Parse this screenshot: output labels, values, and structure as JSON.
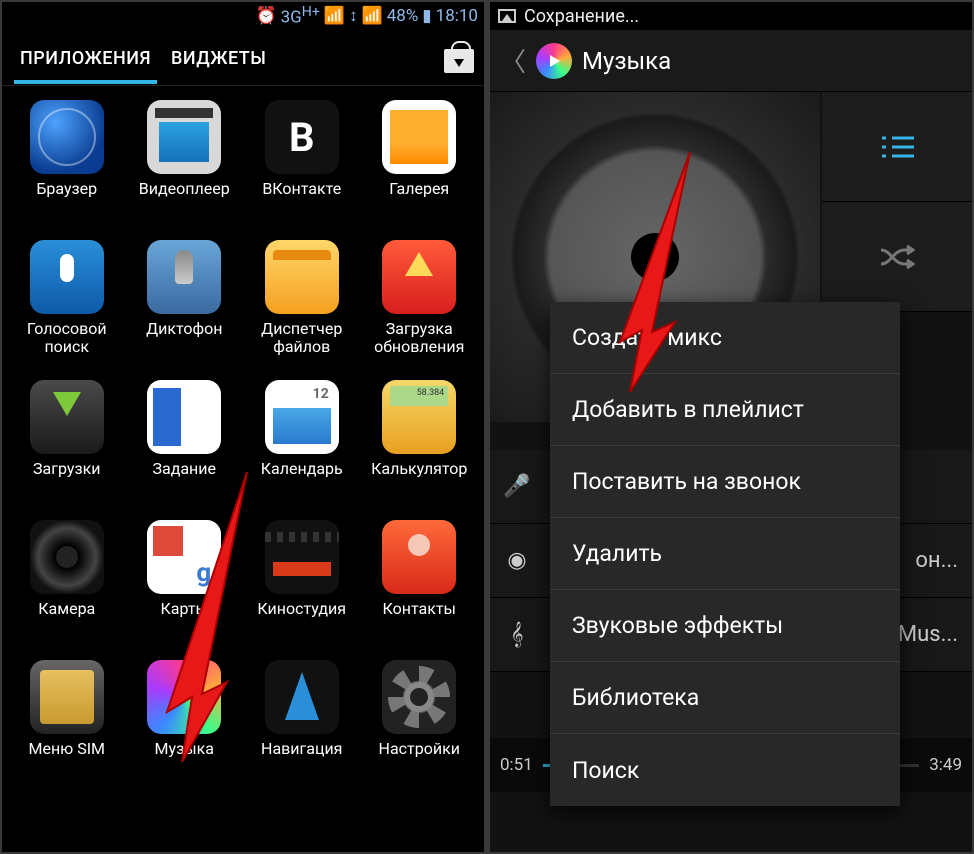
{
  "left": {
    "status": {
      "network": "3G",
      "network_sup": "H+",
      "battery": "48%",
      "time": "18:10"
    },
    "tabs": {
      "apps": "ПРИЛОЖЕНИЯ",
      "widgets": "ВИДЖЕТЫ"
    },
    "apps": [
      {
        "id": "browser",
        "label": "Браузер"
      },
      {
        "id": "video",
        "label": "Видеоплеер"
      },
      {
        "id": "vk",
        "label": "ВКонтакте"
      },
      {
        "id": "gallery",
        "label": "Галерея"
      },
      {
        "id": "voice",
        "label": "Голосовой\nпоиск"
      },
      {
        "id": "rec",
        "label": "Диктофон"
      },
      {
        "id": "files",
        "label": "Диспетчер\nфайлов"
      },
      {
        "id": "update",
        "label": "Загрузка\nобновления"
      },
      {
        "id": "downloads",
        "label": "Загрузки"
      },
      {
        "id": "task",
        "label": "Задание"
      },
      {
        "id": "cal",
        "label": "Календарь"
      },
      {
        "id": "calc",
        "label": "Калькулятор"
      },
      {
        "id": "camera",
        "label": "Камера"
      },
      {
        "id": "maps",
        "label": "Карты"
      },
      {
        "id": "movie",
        "label": "Киностудия"
      },
      {
        "id": "contacts",
        "label": "Контакты"
      },
      {
        "id": "sim",
        "label": "Меню SIM"
      },
      {
        "id": "music",
        "label": "Музыка"
      },
      {
        "id": "nav",
        "label": "Навигация"
      },
      {
        "id": "settings",
        "label": "Настройки"
      }
    ]
  },
  "right": {
    "status": "Сохранение...",
    "header": "Музыка",
    "menu": [
      "Создать микс",
      "Добавить в плейлист",
      "Поставить на звонок",
      "Удалить",
      "Звуковые эффекты",
      "Библиотека",
      "Поиск"
    ],
    "bg_rows": {
      "ringtone_partial": "он...",
      "tracks_partial": "Mus..."
    },
    "progress": {
      "elapsed": "0:51",
      "total": "3:49"
    }
  }
}
